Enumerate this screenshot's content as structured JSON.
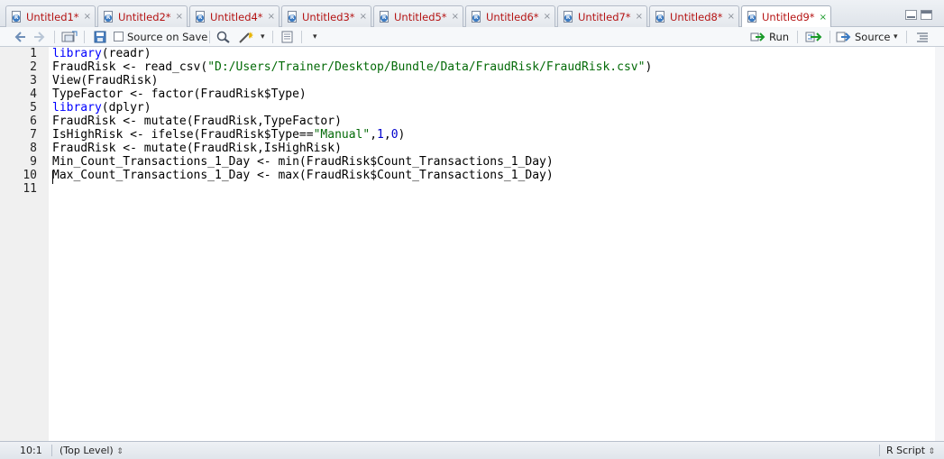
{
  "tabs": [
    {
      "label": "Untitled1*"
    },
    {
      "label": "Untitled2*"
    },
    {
      "label": "Untitled4*"
    },
    {
      "label": "Untitled3*"
    },
    {
      "label": "Untitled5*"
    },
    {
      "label": "Untitled6*"
    },
    {
      "label": "Untitled7*"
    },
    {
      "label": "Untitled8*"
    },
    {
      "label": "Untitled9*",
      "active": true
    }
  ],
  "tab_close_glyph": "×",
  "toolbar": {
    "source_on_save_label": "Source on Save",
    "run_label": "Run",
    "source_label": "Source",
    "dropdown_glyph": "▾"
  },
  "line_numbers": [
    "1",
    "2",
    "3",
    "4",
    "5",
    "6",
    "7",
    "8",
    "9",
    "10",
    "11"
  ],
  "code": {
    "l1": {
      "kw": "library",
      "rest": "(readr)"
    },
    "l2": {
      "pre": "FraudRisk <- read_csv(",
      "str": "\"D:/Users/Trainer/Desktop/Bundle/Data/FraudRisk/FraudRisk.csv\"",
      "post": ")"
    },
    "l3": {
      "text": "View(FraudRisk)"
    },
    "l4": {
      "text": "TypeFactor <- factor(FraudRisk$Type)"
    },
    "l5": {
      "kw": "library",
      "rest": "(dplyr)"
    },
    "l6": {
      "text": "FraudRisk <- mutate(FraudRisk,TypeFactor)"
    },
    "l7": {
      "pre": "IsHighRisk <- ifelse(FraudRisk$Type==",
      "str": "\"Manual\"",
      "mid1": ",",
      "num1": "1",
      "mid2": ",",
      "num2": "0",
      "post": ")"
    },
    "l8": {
      "text": "FraudRisk <- mutate(FraudRisk,IsHighRisk)"
    },
    "l9": {
      "text": "Min_Count_Transactions_1_Day <- min(FraudRisk$Count_Transactions_1_Day)"
    },
    "l10": {
      "text": "Max_Count_Transactions_1_Day <- max(FraudRisk$Count_Transactions_1_Day)"
    }
  },
  "status": {
    "position": "10:1",
    "scope": "(Top Level)",
    "scope_arrows": "⇕",
    "language": "R Script"
  },
  "colors": {
    "tab_text": "#b51414",
    "keyword": "#0000ff",
    "string": "#036a07",
    "number": "#0000cd"
  }
}
